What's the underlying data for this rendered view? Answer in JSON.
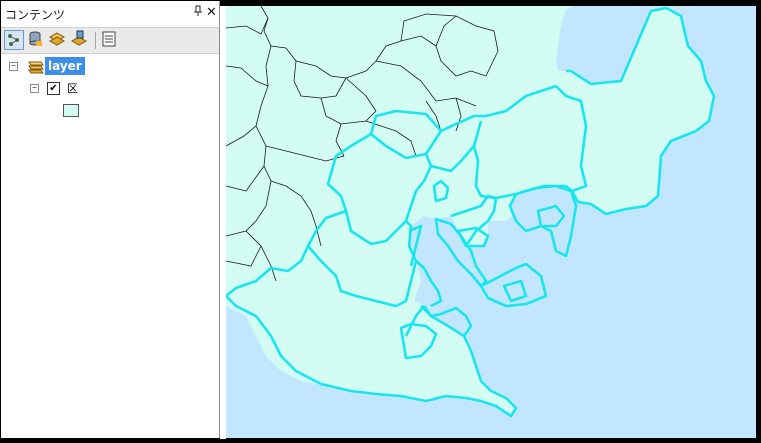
{
  "toc": {
    "title": "コンテンツ",
    "pin_glyph": "ㅁ",
    "close_glyph": "✕",
    "toolbar": {
      "buttons": [
        "list-by-drawing-order",
        "list-by-source",
        "list-by-visibility",
        "list-by-selection",
        "options"
      ]
    },
    "tree": {
      "layer_name": "layer",
      "layer_expander": "−",
      "sublayer_expander": "−",
      "sublayer_checked": "✔",
      "sublayer_label": "区",
      "swatch_color": "#d3fdf3"
    }
  },
  "map": {
    "sea_color": "#c3e6ff",
    "land_color": "#d3fdf3",
    "highlight_outline": "#19e6ec",
    "boundary_color": "#1a1a1a"
  }
}
